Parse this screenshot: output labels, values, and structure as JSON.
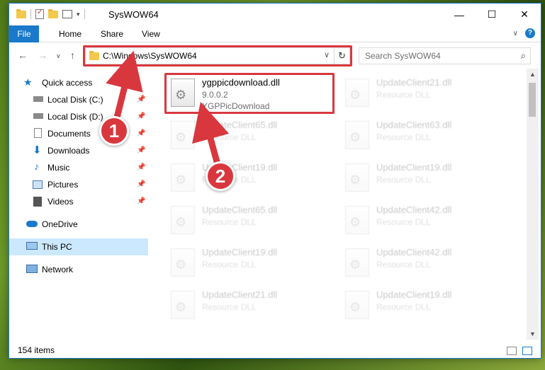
{
  "window": {
    "title": "SysWOW64",
    "controls": [
      "—",
      "☐",
      "✕"
    ]
  },
  "ribbon": {
    "tabs": [
      "File",
      "Home",
      "Share",
      "View"
    ],
    "expand_icon": "chevron-down-icon",
    "help": "?"
  },
  "nav": {
    "back": "←",
    "forward": "→",
    "recent": "∨",
    "up": "↑"
  },
  "address": {
    "path": "C:\\Windows\\SysWOW64",
    "refresh": "↻",
    "dropdown": "∨"
  },
  "search": {
    "placeholder": "Search SysWOW64",
    "icon": "⌕"
  },
  "sidebar": {
    "items": [
      {
        "label": "Quick access",
        "icon": "star-icon"
      },
      {
        "label": "Local Disk (C:)",
        "icon": "drive-icon",
        "pinned": true
      },
      {
        "label": "Local Disk (D:)",
        "icon": "drive-icon",
        "pinned": true
      },
      {
        "label": "Documents",
        "icon": "documents-icon",
        "pinned": true
      },
      {
        "label": "Downloads",
        "icon": "download-icon",
        "pinned": true
      },
      {
        "label": "Music",
        "icon": "music-icon",
        "pinned": true
      },
      {
        "label": "Pictures",
        "icon": "pictures-icon",
        "pinned": true
      },
      {
        "label": "Videos",
        "icon": "videos-icon",
        "pinned": true
      },
      {
        "label": "OneDrive",
        "icon": "cloud-icon"
      },
      {
        "label": "This PC",
        "icon": "computer-icon",
        "selected": true
      },
      {
        "label": "Network",
        "icon": "network-icon"
      }
    ]
  },
  "files": {
    "highlighted": {
      "name": "ygppicdownload.dll",
      "version": "9.0.0.2",
      "description": "YGPPicDownload"
    },
    "others": [
      {
        "name": "UpdateClient21.dll",
        "type": "Resource DLL"
      },
      {
        "name": "UpdateClient65.dll",
        "type": "Resource DLL"
      },
      {
        "name": "UpdateClient63.dll",
        "type": "Resource DLL"
      },
      {
        "name": "UpdateClient19.dll",
        "type": "Resource DLL"
      },
      {
        "name": "UpdateClient19.dll",
        "type": "Resource DLL"
      },
      {
        "name": "UpdateClient65.dll",
        "type": "Resource DLL"
      },
      {
        "name": "UpdateClient42.dll",
        "type": "Resource DLL"
      },
      {
        "name": "UpdateClient19.dll",
        "type": "Resource DLL"
      },
      {
        "name": "UpdateClient42.dll",
        "type": "Resource DLL"
      },
      {
        "name": "UpdateClient21.dll",
        "type": "Resource DLL"
      },
      {
        "name": "UpdateClient19.dll",
        "type": "Resource DLL"
      }
    ]
  },
  "status": {
    "item_count": "154 items"
  },
  "annotations": {
    "badge1": "1",
    "badge2": "2",
    "color": "#d9373e"
  }
}
